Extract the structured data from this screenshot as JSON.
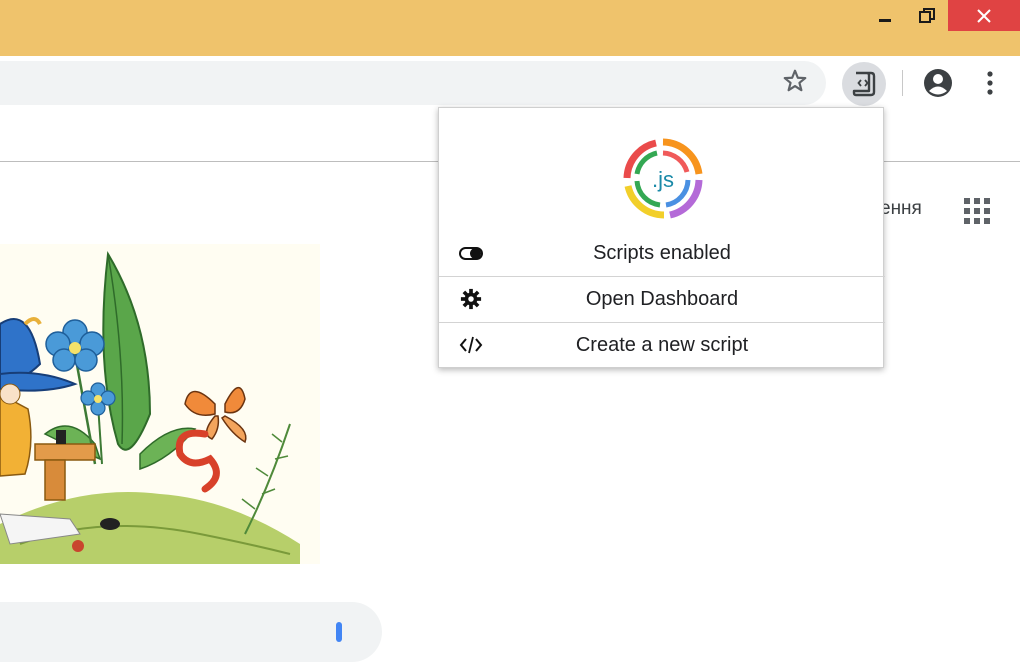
{
  "window": {
    "controls": [
      "minimize",
      "maximize",
      "close"
    ]
  },
  "toolbar": {
    "bookmark_icon": "star-icon",
    "extension_icon": "script-extension-icon",
    "profile_icon": "account-circle-icon",
    "menu_icon": "more-vert-icon"
  },
  "page": {
    "apps_link_text": "ення",
    "apps_icon": "apps-grid-icon",
    "doodle_icon": "doodle-illustration"
  },
  "popup": {
    "logo_text": ".js",
    "items": [
      {
        "label": "Scripts enabled",
        "icon": "toggle-icon"
      },
      {
        "label": "Open Dashboard",
        "icon": "gear-icon"
      },
      {
        "label": "Create a new script",
        "icon": "code-icon"
      }
    ]
  },
  "colors": {
    "titlebar": "#efc36c",
    "close_button": "#e04343",
    "omnibox": "#f1f3f4"
  }
}
